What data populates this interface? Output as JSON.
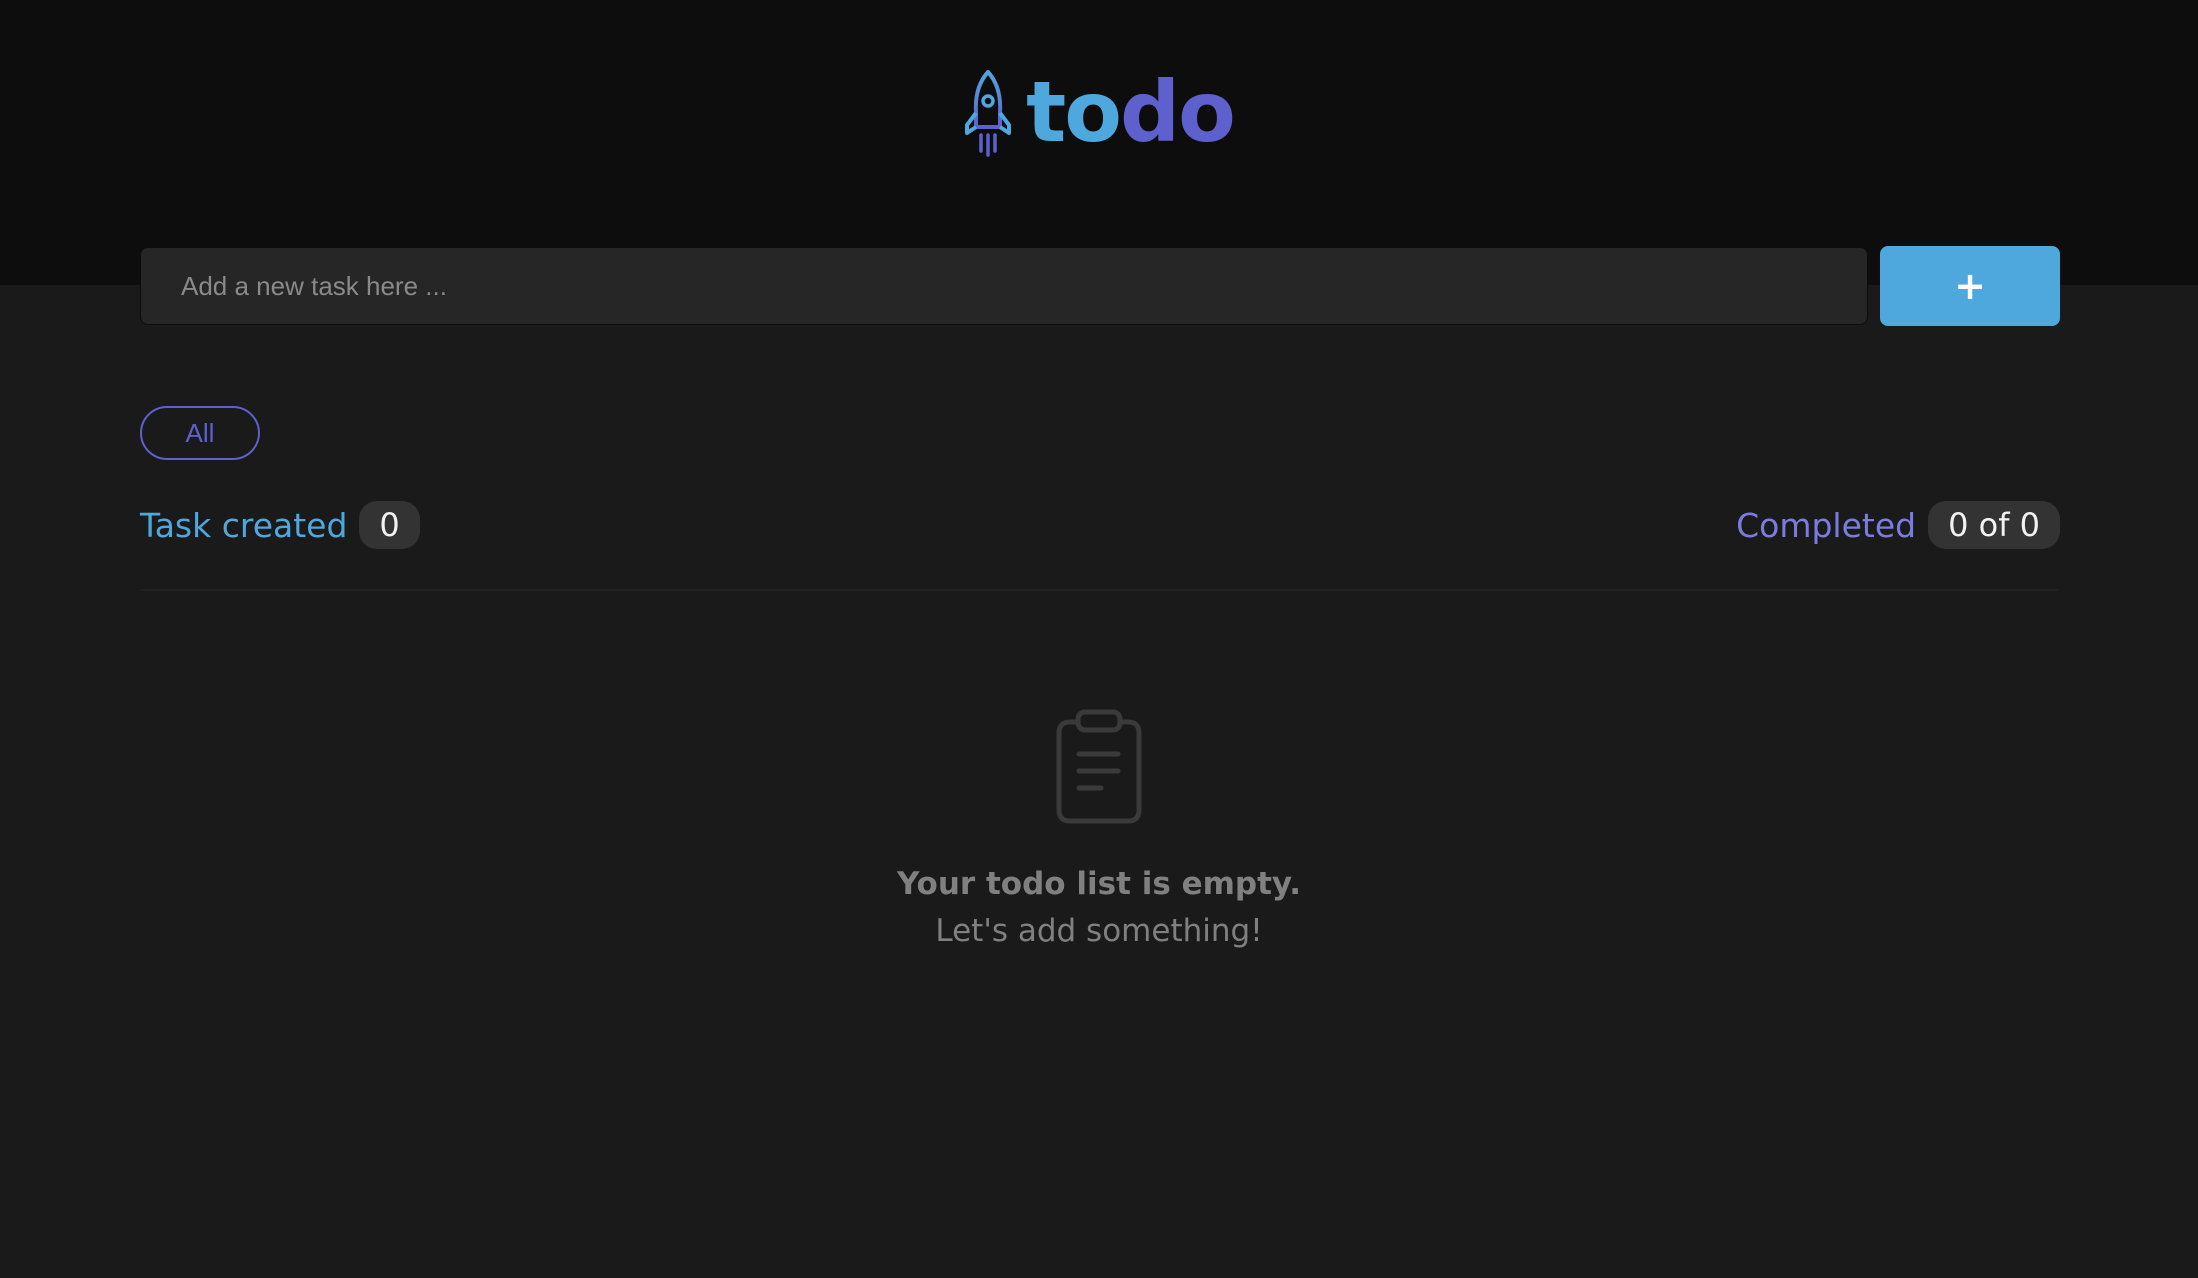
{
  "header": {
    "logo_icon": "rocket-icon",
    "title_part1": "to",
    "title_part2": "do"
  },
  "new_task": {
    "placeholder": "Add a new task here ...",
    "add_button_label": "+"
  },
  "filters": [
    {
      "label": "All",
      "active": true
    }
  ],
  "stats": {
    "created_label": "Task created",
    "created_count": "0",
    "completed_label": "Completed",
    "completed_value": "0 of 0"
  },
  "empty_state": {
    "icon": "clipboard-icon",
    "title": "Your todo list is empty.",
    "subtitle": "Let's add something!"
  },
  "colors": {
    "primary": "#4ea8de",
    "secondary": "#5e60ce",
    "background": "#1a1a1a",
    "header_background": "#0d0d0d"
  }
}
